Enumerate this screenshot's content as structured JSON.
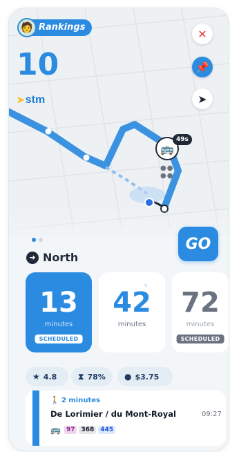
{
  "header": {
    "rankings_label": "Rankings",
    "route_number": "10",
    "agency": "stm"
  },
  "map": {
    "vehicle_eta": "49s"
  },
  "go_label": "GO",
  "direction": "North",
  "departures": [
    {
      "value": "13",
      "unit": "minutes",
      "badge": "SCHEDULED"
    },
    {
      "value": "42",
      "unit": "minutes",
      "badge": ""
    },
    {
      "value": "72",
      "unit": "minutes",
      "badge": "SCHEDULED"
    }
  ],
  "stats": {
    "rating": "4.8",
    "occupancy": "78%",
    "fare": "$3.75"
  },
  "stop": {
    "walk_time": "2 minutes",
    "name": "De Lorimier / du Mont-Royal",
    "time": "09:27",
    "routes": [
      "97",
      "368",
      "445"
    ]
  },
  "colors": {
    "accent": "#2b8be0",
    "close": "#e53935",
    "dark": "#1f2937"
  }
}
